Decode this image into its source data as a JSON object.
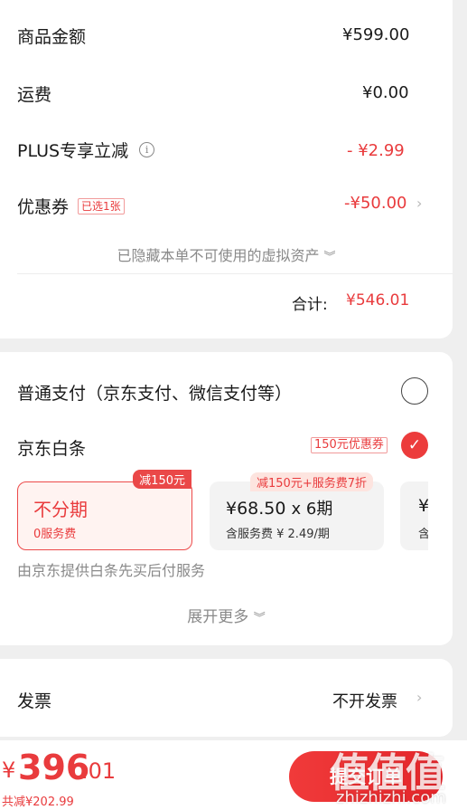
{
  "price_summary": {
    "goods_amount_label": "商品金额",
    "goods_amount_value": "¥599.00",
    "shipping_label": "运费",
    "shipping_value": "¥0.00",
    "plus_label": "PLUS专享立减",
    "plus_info_icon": "info-icon",
    "plus_value": "- ¥2.99",
    "coupon_label": "优惠券",
    "coupon_tag": "已选1张",
    "coupon_value": "-¥50.00",
    "hidden_assets_hint": "已隐藏本单不可使用的虚拟资产",
    "total_label": "合计:",
    "total_value": "¥546.01"
  },
  "payment": {
    "normal_label": "普通支付（京东支付、微信支付等）",
    "baitiao_label": "京东白条",
    "baitiao_tag": "150元优惠券",
    "plans": [
      {
        "badge": "减150元",
        "title": "不分期",
        "subtitle": "0服务费"
      },
      {
        "badge": "减150元+服务费7折",
        "title_amount": "¥68.50",
        "title_times": "x 6期",
        "subtitle": "含服务费 ¥ 2.49/期"
      },
      {
        "title": "¥",
        "subtitle": "含"
      }
    ],
    "provider_note": "由京东提供白条先买后付服务",
    "expand_more": "展开更多"
  },
  "invoice": {
    "label": "发票",
    "value": "不开发票"
  },
  "bottom_bar": {
    "currency": "¥",
    "amount_int": "396",
    "amount_dec": ".01",
    "total_discount": "共减¥202.99",
    "submit_label": "提交订单"
  },
  "watermark": {
    "glyphs": "值值值",
    "url": "zhizhizhi.com"
  },
  "colors": {
    "accent_red": "#e93b3d",
    "background": "#efefef"
  }
}
